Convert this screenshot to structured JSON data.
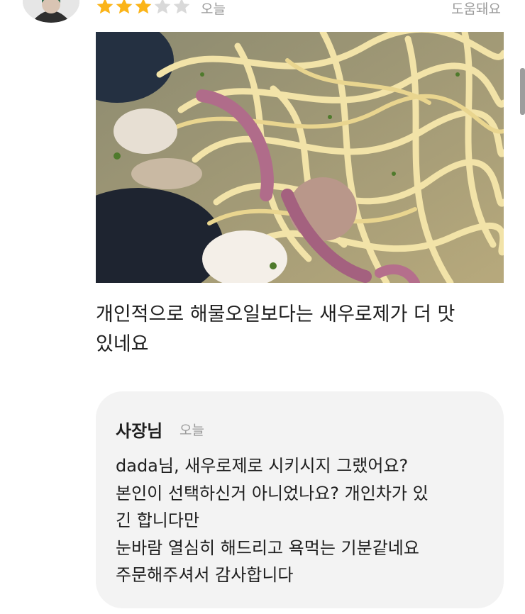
{
  "review": {
    "rating": 3,
    "rating_max": 5,
    "date": "오늘",
    "helpful_label": "도움돼요",
    "text": "개인적으로 해물오일보다는 새우로제가 더 맛있네요",
    "text_lines": [
      "개인적으로 해물오일보다는 새우로제가 더 맛",
      "있네요"
    ]
  },
  "reply": {
    "author": "사장님",
    "date": "오늘",
    "lines": [
      "dada님, 새우로제로 시키시지 그랬어요?",
      "본인이 선택하신거 아니었나요?  개인차가 있",
      "긴 합니다만",
      "눈바람 열심히 해드리고 욕먹는 기분같네요",
      "주문해주셔서 감사합니다"
    ]
  },
  "colors": {
    "star_filled": "#fbb418",
    "star_empty": "#d9d9d9",
    "reply_bg": "#f3f3f3",
    "muted_text": "#9a9a9a"
  }
}
